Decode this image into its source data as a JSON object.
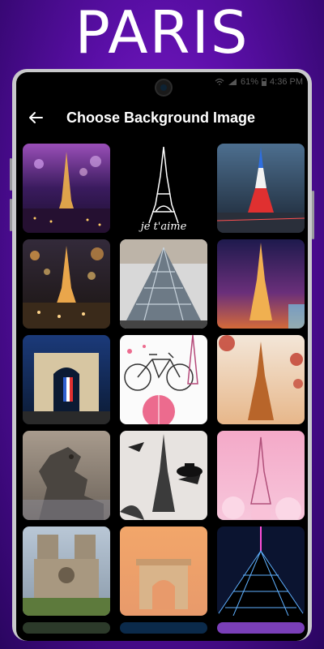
{
  "promo": {
    "headline": "PARIS"
  },
  "status_bar": {
    "battery": "61%",
    "time": "4:36 PM"
  },
  "app_bar": {
    "title": "Choose Background Image",
    "back_icon": "back-arrow-icon"
  },
  "tiles": [
    {
      "name": "eiffel-night-bokeh",
      "caption": ""
    },
    {
      "name": "eiffel-sketch-je-taime",
      "caption": "je t'aime"
    },
    {
      "name": "eiffel-tricolor-lights",
      "caption": ""
    },
    {
      "name": "eiffel-golden-bokeh",
      "caption": ""
    },
    {
      "name": "louvre-pyramid",
      "caption": ""
    },
    {
      "name": "eiffel-purple-dusk",
      "caption": ""
    },
    {
      "name": "arc-de-triomphe-flag",
      "caption": ""
    },
    {
      "name": "bicycle-illustration",
      "caption": ""
    },
    {
      "name": "eiffel-autumn-leaves",
      "caption": ""
    },
    {
      "name": "gargoyle-notre-dame",
      "caption": ""
    },
    {
      "name": "eiffel-hat-birds",
      "caption": ""
    },
    {
      "name": "eiffel-pink-petals",
      "caption": ""
    },
    {
      "name": "notre-dame-cathedral",
      "caption": ""
    },
    {
      "name": "arc-de-triomphe-sunset",
      "caption": ""
    },
    {
      "name": "louvre-pyramid-night",
      "caption": ""
    },
    {
      "name": "partial-tile-1",
      "caption": ""
    },
    {
      "name": "partial-tile-2",
      "caption": ""
    },
    {
      "name": "partial-tile-3",
      "caption": ""
    }
  ],
  "colors": {
    "screen_bg": "#000000",
    "headline": "#ffffff",
    "bezel": "#c9c9cc"
  }
}
